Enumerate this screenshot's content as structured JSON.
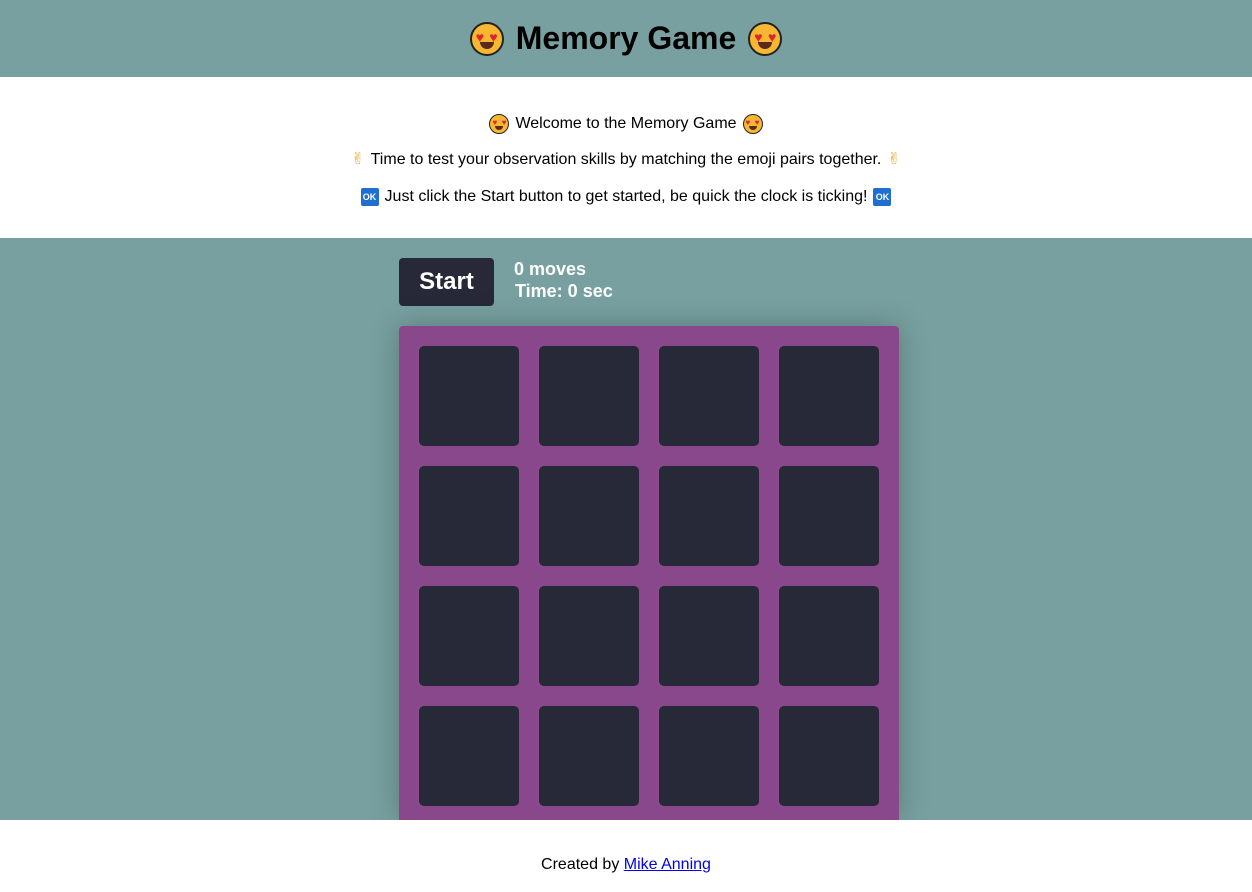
{
  "header": {
    "title": "Memory Game",
    "emoji": "heart-eyes"
  },
  "intro": {
    "line1": "Welcome to the Memory Game",
    "line2": "Time to test your observation skills by matching the emoji pairs together.",
    "line3": "Just click the Start button to get started, be quick the clock is ticking!",
    "ok_label": "OK"
  },
  "controls": {
    "start_label": "Start",
    "moves": "0 moves",
    "time": "Time: 0 sec"
  },
  "board": {
    "rows": 4,
    "cols": 4,
    "card_state": "face-down"
  },
  "footer": {
    "prefix": "Created by",
    "author": "Mike Anning"
  },
  "colors": {
    "header_bg": "#78a0a0",
    "board_bg": "#89488b",
    "card_bg": "#272838",
    "button_bg": "#272838"
  }
}
